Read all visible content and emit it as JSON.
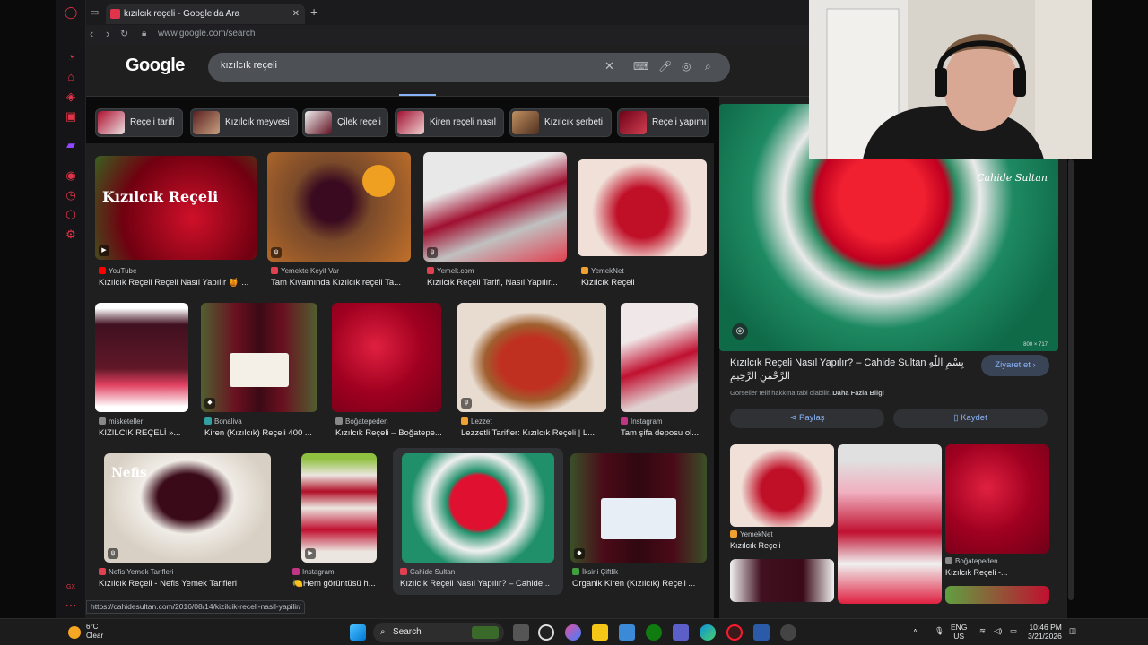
{
  "browser": {
    "tab_title": "kızılcık reçeli - Google'da Ara",
    "url": "www.google.com/search",
    "status_url": "https://cahidesultan.com/2016/08/14/kizilcik-receli-nasil-yapilir/"
  },
  "google": {
    "logo": "Google",
    "query": "kızılcık reçeli"
  },
  "chips": [
    {
      "label": "Reçeli tarifi"
    },
    {
      "label": "Kızılcık meyvesi"
    },
    {
      "label": "Çilek reçeli"
    },
    {
      "label": "Kiren reçeli nasıl"
    },
    {
      "label": "Kızılcık şerbeti"
    },
    {
      "label": "Reçeli yapımı"
    }
  ],
  "results": [
    {
      "source": "YouTube",
      "title": "Kızılcık Reçeli Reçeli Nasıl Yapılır 🍯 ...",
      "overlay": "Kızılcık Reçeli"
    },
    {
      "source": "Yemekte Keyif Var",
      "title": "Tam Kıvamında Kızılcık reçeli Ta..."
    },
    {
      "source": "Yemek.com",
      "title": "Kızılcık Reçeli Tarifi, Nasıl Yapılır..."
    },
    {
      "source": "YemekNet",
      "title": "Kızılcık Reçeli"
    },
    {
      "source": "misketeller",
      "title": "KIZILCIK REÇELİ »..."
    },
    {
      "source": "Bonaliva",
      "title": "Kiren (Kızılcık) Reçeli 400 ..."
    },
    {
      "source": "Boğatepeden",
      "title": "Kızılcık Reçeli – Boğatepe..."
    },
    {
      "source": "Lezzet",
      "title": "Lezzetli Tarifler: Kızılcık Reçeli | L..."
    },
    {
      "source": "Instagram",
      "title": "Tam şifa deposu ol..."
    },
    {
      "source": "Nefis Yemek Tarifleri",
      "title": "Kızılcık Reçeli - Nefis Yemek Tarifleri",
      "overlay": "Nefis"
    },
    {
      "source": "Instagram",
      "title": "🍋Hem görüntüsü h..."
    },
    {
      "source": "Cahide Sultan",
      "title": "Kızılcık Reçeli Nasıl Yapılır? – Cahide..."
    },
    {
      "source": "İksirli Çiftlik",
      "title": "Organik Kiren (Kızılcık) Reçeli ..."
    }
  ],
  "preview": {
    "title": "Kızılcık Reçeli Nasıl Yapılır? – Cahide Sultan بِسْمِ اللّٰهِ الرَّحْمٰنِ الرَّحِيمِ",
    "visit_label": "Ziyaret et",
    "copyright": "Görseller telif hakkına tabi olabilir.",
    "more_info": "Daha Fazla Bilgi",
    "share_label": "Paylaş",
    "save_label": "Kaydet",
    "dims": "800 × 717",
    "watermark": "Cahide Sultan",
    "related": [
      {
        "source": "YemekNet",
        "title": "Kızılcık Reçeli"
      },
      {
        "source": "",
        "title": ""
      },
      {
        "source": "Boğatepeden",
        "title": "Kızılcık Reçeli -..."
      }
    ]
  },
  "taskbar": {
    "temp": "6°C",
    "weather": "Clear",
    "search": "Search",
    "lang1": "ENG",
    "lang2": "US",
    "time": "10:46 PM",
    "date": "3/21/2026"
  },
  "colors": {
    "accent": "#8ab4f8",
    "opera_red": "#e0344a",
    "bg": "#1f1f1f"
  }
}
